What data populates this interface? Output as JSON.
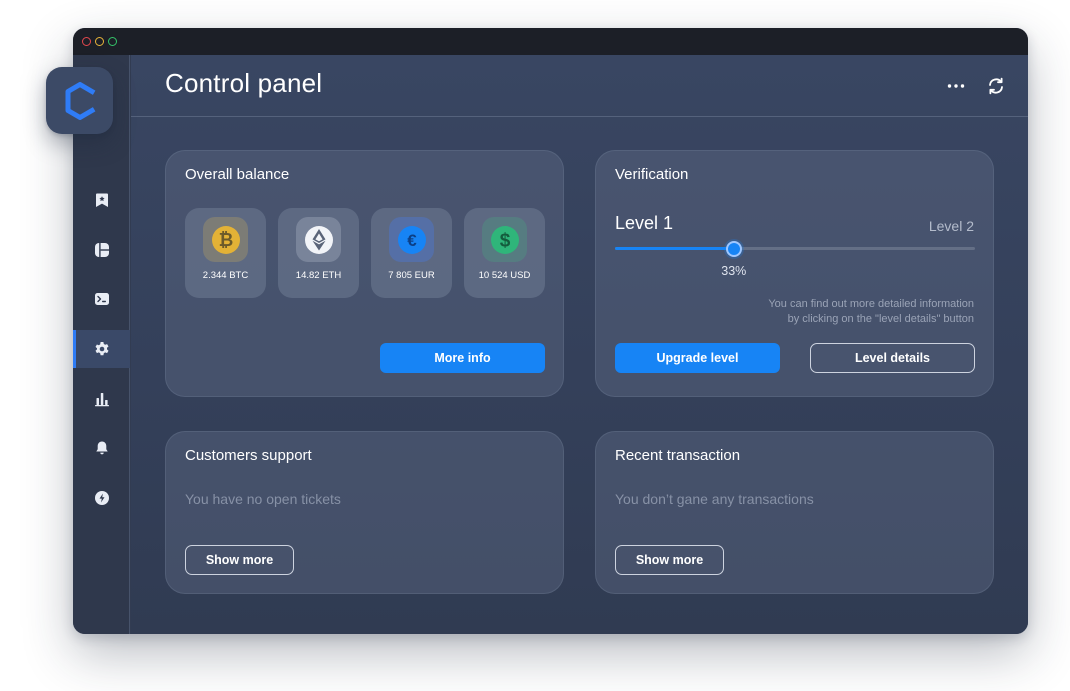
{
  "window": {
    "controls": [
      "close",
      "minimize",
      "maximize"
    ]
  },
  "logo": {
    "icon": "brand-c-logo",
    "color": "#2f7cf6"
  },
  "header": {
    "title": "Control panel",
    "icons": [
      "more-horizontal-icon",
      "refresh-icon"
    ]
  },
  "sidebar": {
    "items": [
      {
        "icon": "bookmark-icon",
        "active": false
      },
      {
        "icon": "dashboard-icon",
        "active": false
      },
      {
        "icon": "terminal-icon",
        "active": false
      },
      {
        "icon": "settings-icon",
        "active": true
      },
      {
        "icon": "bar-chart-icon",
        "active": false
      },
      {
        "icon": "bell-icon",
        "active": false
      },
      {
        "icon": "lightning-icon",
        "active": false
      }
    ]
  },
  "balance": {
    "title": "Overall balance",
    "coins": [
      {
        "icon": "bitcoin-icon",
        "value": "2.344 BTC",
        "color": "#e6b63a"
      },
      {
        "icon": "ethereum-icon",
        "value": "14.82 ETH",
        "color": "#ffffff"
      },
      {
        "icon": "euro-icon",
        "value": "7 805 EUR",
        "color": "#1784f5"
      },
      {
        "icon": "dollar-icon",
        "value": "10 524 USD",
        "color": "#2fb57a"
      }
    ],
    "more_info": "More info"
  },
  "verification": {
    "title": "Verification",
    "current_level": "Level 1",
    "next_level": "Level 2",
    "progress": 0.33,
    "progress_label": "33%",
    "help_line1": "You can find out more detailed information",
    "help_line2": "by clicking on the \"level details\" button",
    "upgrade_label": "Upgrade level",
    "details_label": "Level details"
  },
  "support": {
    "title": "Customers support",
    "empty_text": "You have no open tickets",
    "show_more": "Show more"
  },
  "transactions": {
    "title": "Recent transaction",
    "empty_text": "You don’t gane any transactions",
    "show_more": "Show more"
  },
  "colors": {
    "accent": "#1784f5",
    "panel": "#323c52"
  }
}
